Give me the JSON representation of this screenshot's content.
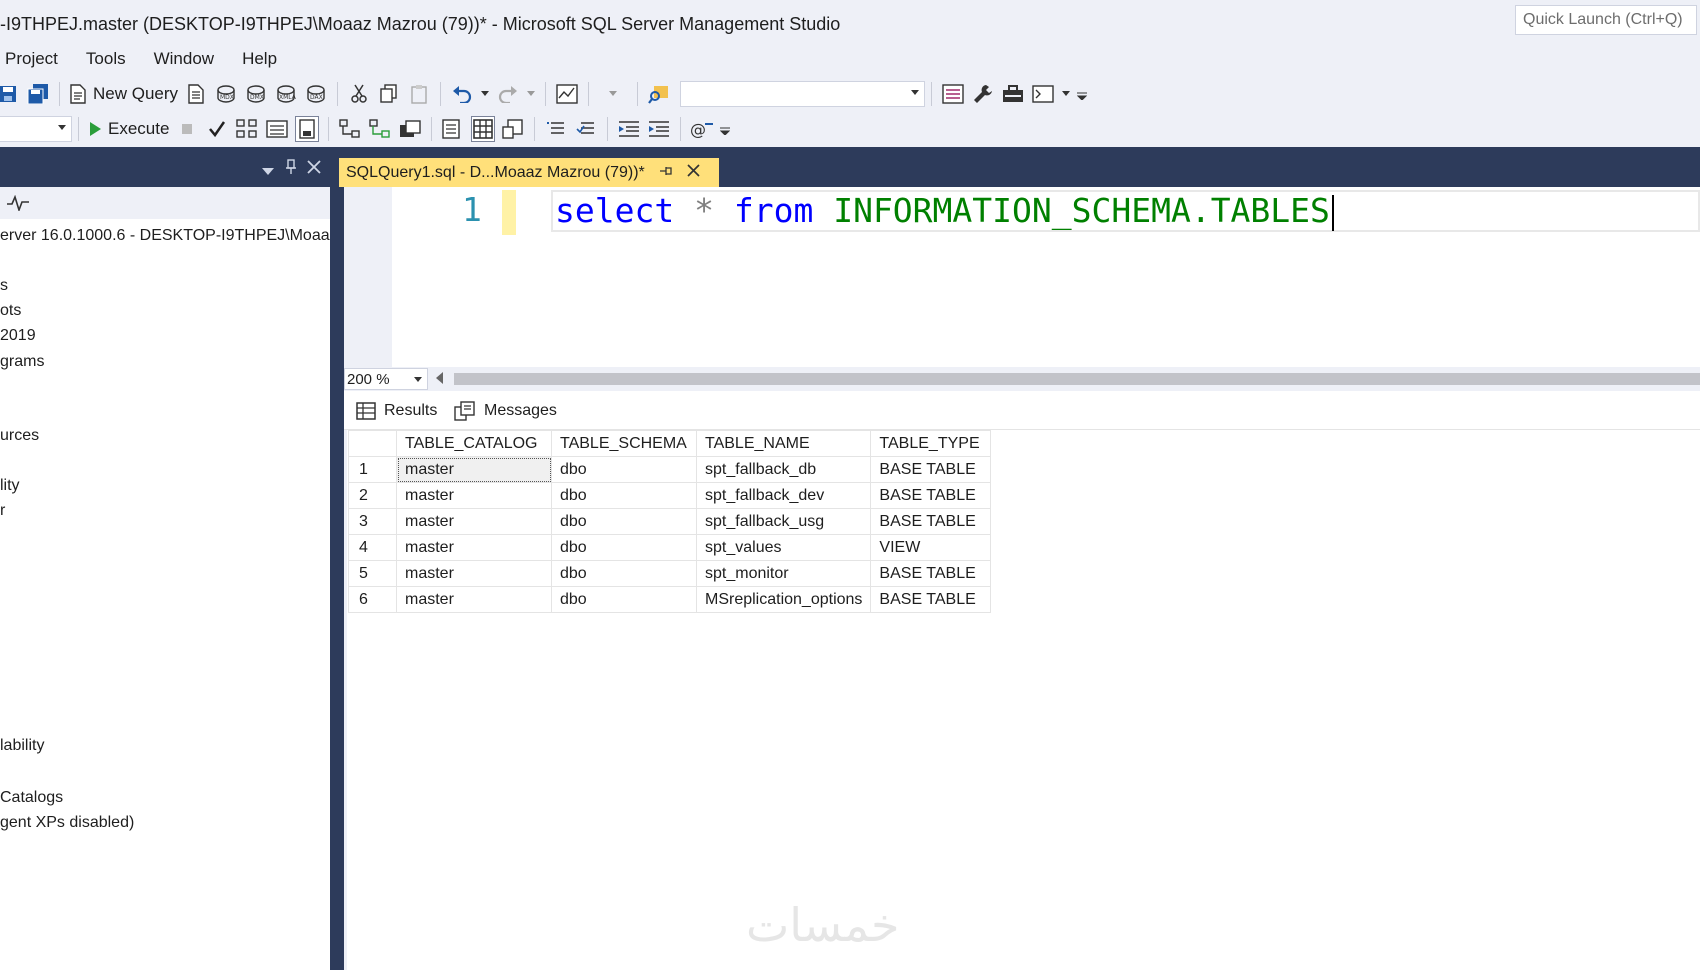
{
  "window": {
    "title": "-I9THPEJ.master (DESKTOP-I9THPEJ\\Moaaz Mazrou (79))* - Microsoft SQL Server Management Studio",
    "quick_launch_placeholder": "Quick Launch (Ctrl+Q)"
  },
  "menu": [
    "Project",
    "Tools",
    "Window",
    "Help"
  ],
  "toolbar": {
    "new_query": "New Query",
    "execute": "Execute",
    "icons_row1": [
      "save-icon",
      "save-all-icon",
      "new-query-icon",
      "mdx-query-icon",
      "dmx-query-icon",
      "xmla-query-icon",
      "dax-query-icon",
      "cut-icon",
      "copy-icon",
      "paste-icon",
      "undo-icon",
      "redo-icon",
      "activity-monitor-icon",
      "find-icon",
      "properties-icon",
      "wrench-icon",
      "toolbox-icon",
      "command-window-icon"
    ],
    "icons_row2": [
      "execute-icon",
      "stop-icon",
      "parse-check-icon",
      "estimated-plan-icon",
      "query-options-icon",
      "intellisense-icon",
      "actual-plan-icon",
      "client-stats-icon",
      "results-text-icon",
      "results-grid-icon",
      "results-file-icon",
      "comment-icon",
      "uncomment-icon",
      "decrease-indent-icon",
      "increase-indent-icon",
      "specify-values-icon"
    ]
  },
  "object_explorer": {
    "server_node": "erver 16.0.1000.6 - DESKTOP-I9THPEJ\\Moaa",
    "tree_items": [
      "s",
      "ots",
      "2019",
      "grams",
      "urces",
      "lity",
      "r",
      "lability",
      "Catalogs",
      "gent XPs disabled)"
    ]
  },
  "editor": {
    "tab_title": "SQLQuery1.sql - D...Moaaz Mazrou (79))*",
    "line_number": "1",
    "code": {
      "select": "select",
      "star": "*",
      "from": "from",
      "object": "INFORMATION_SCHEMA.TABLES"
    },
    "zoom": "200 %"
  },
  "results": {
    "tabs": [
      "Results",
      "Messages"
    ],
    "columns": [
      "TABLE_CATALOG",
      "TABLE_SCHEMA",
      "TABLE_NAME",
      "TABLE_TYPE"
    ],
    "rows": [
      [
        "1",
        "master",
        "dbo",
        "spt_fallback_db",
        "BASE TABLE"
      ],
      [
        "2",
        "master",
        "dbo",
        "spt_fallback_dev",
        "BASE TABLE"
      ],
      [
        "3",
        "master",
        "dbo",
        "spt_fallback_usg",
        "BASE TABLE"
      ],
      [
        "4",
        "master",
        "dbo",
        "spt_values",
        "VIEW"
      ],
      [
        "5",
        "master",
        "dbo",
        "spt_monitor",
        "BASE TABLE"
      ],
      [
        "6",
        "master",
        "dbo",
        "MSreplication_options",
        "BASE TABLE"
      ]
    ]
  },
  "watermark": "خمسات",
  "colors": {
    "chrome_bg": "#eef0f7",
    "dark_header": "#2d3b5b",
    "active_tab": "#ffe07a",
    "keyword": "#0000ff",
    "object_name": "#008000",
    "line_number": "#2b91af"
  }
}
